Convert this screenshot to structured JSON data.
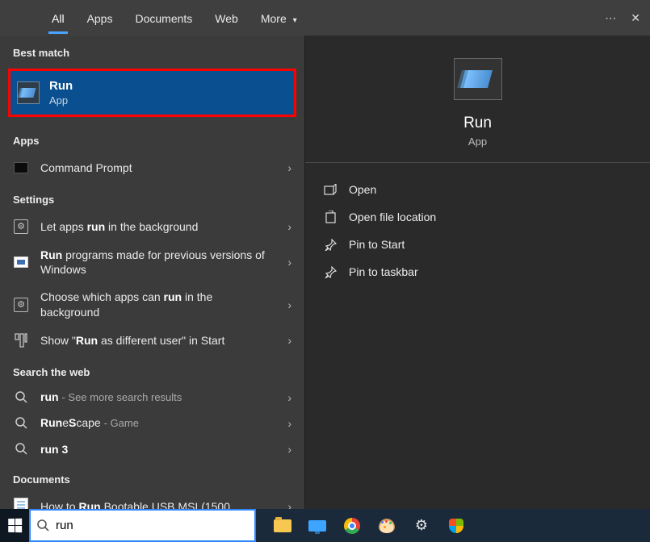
{
  "header": {
    "tabs": [
      "All",
      "Apps",
      "Documents",
      "Web",
      "More"
    ],
    "more_icon": "▾"
  },
  "left": {
    "best_match_label": "Best match",
    "best_match": {
      "title": "Run",
      "subtitle": "App"
    },
    "sections": {
      "apps_label": "Apps",
      "apps": [
        {
          "label_html": "Command Prompt"
        }
      ],
      "settings_label": "Settings",
      "settings": [
        {
          "label_html": "Let apps <b>run</b> in the background"
        },
        {
          "label_html": "<b>Run</b> programs made for previous versions of Windows"
        },
        {
          "label_html": "Choose which apps can <b>run</b> in the background"
        },
        {
          "label_html": "Show \"<b>Run</b> as different user\" in Start"
        }
      ],
      "web_label": "Search the web",
      "web": [
        {
          "label_html": "<b>run</b> <span class='sub'>- See more search results</span>"
        },
        {
          "label_html": "<b>Run</b>e<b>S</b>cape <span class='sub'>- Game</span>"
        },
        {
          "label_html": "<b>run 3</b>"
        }
      ],
      "documents_label": "Documents",
      "documents": [
        {
          "label_html": "How to <b>Run</b> Bootable USB MSI (1500"
        }
      ]
    }
  },
  "right": {
    "title": "Run",
    "subtitle": "App",
    "actions": [
      {
        "name": "open",
        "label": "Open",
        "icon": "open"
      },
      {
        "name": "open-file-location",
        "label": "Open file location",
        "icon": "location"
      },
      {
        "name": "pin-to-start",
        "label": "Pin to Start",
        "icon": "pin"
      },
      {
        "name": "pin-to-taskbar",
        "label": "Pin to taskbar",
        "icon": "pin"
      }
    ]
  },
  "taskbar": {
    "search_value": "run",
    "items": [
      "file-explorer",
      "your-phone",
      "chrome",
      "paint",
      "settings",
      "security"
    ]
  }
}
